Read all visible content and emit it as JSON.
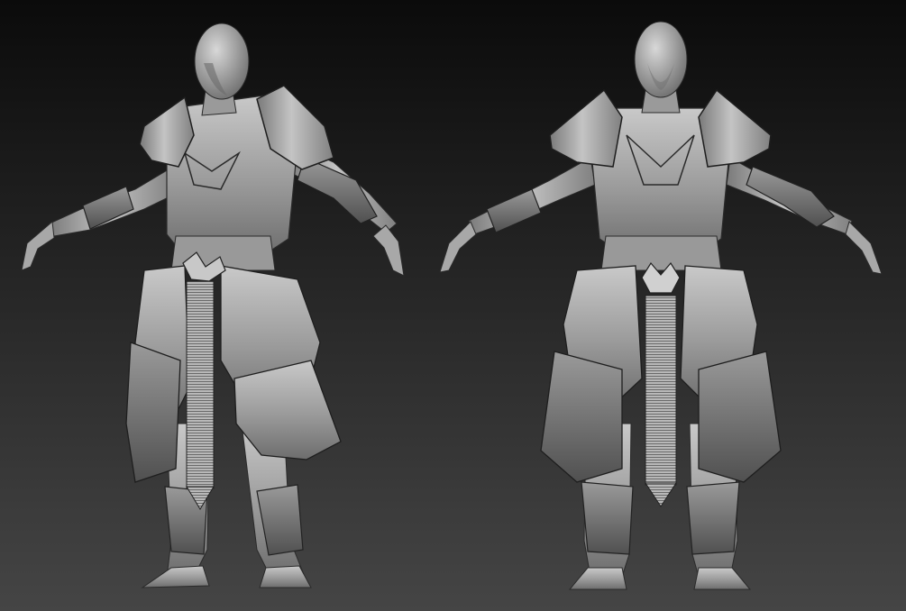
{
  "scene": {
    "background_top": "#0b0b0b",
    "background_bottom": "#454545",
    "clay_light": "#cfcfcf",
    "clay_mid": "#8e8e8e",
    "clay_dark": "#3c3c3c",
    "line_color": "#1c1c1c"
  },
  "models": [
    {
      "view": "three-quarter"
    },
    {
      "view": "front"
    }
  ]
}
